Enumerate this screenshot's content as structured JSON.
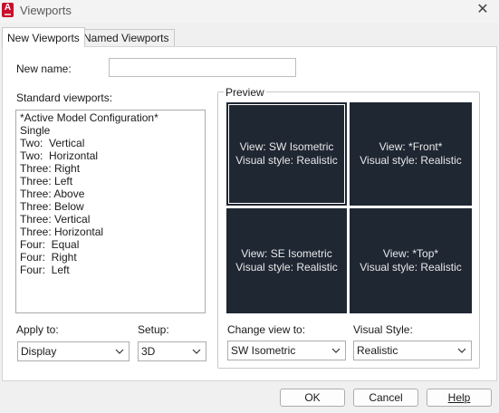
{
  "window": {
    "title": "Viewports",
    "close_glyph": "✕"
  },
  "tabs": [
    {
      "label": "New Viewports",
      "active": true
    },
    {
      "label": "Named Viewports",
      "active": false
    }
  ],
  "new_name": {
    "label": "New name:",
    "value": ""
  },
  "standard_viewports": {
    "label": "Standard viewports:",
    "items": [
      "*Active Model Configuration*",
      "Single",
      "Two:  Vertical",
      "Two:  Horizontal",
      "Three: Right",
      "Three: Left",
      "Three: Above",
      "Three: Below",
      "Three: Vertical",
      "Three: Horizontal",
      "Four:  Equal",
      "Four:  Right",
      "Four:  Left"
    ]
  },
  "preview": {
    "label": "Preview",
    "viewports": [
      {
        "view": "View: SW Isometric",
        "style": "Visual style: Realistic",
        "selected": true
      },
      {
        "view": "View: *Front*",
        "style": "Visual style: Realistic",
        "selected": false
      },
      {
        "view": "View: SE Isometric",
        "style": "Visual style: Realistic",
        "selected": false
      },
      {
        "view": "View: *Top*",
        "style": "Visual style: Realistic",
        "selected": false
      }
    ]
  },
  "apply_to": {
    "label": "Apply to:",
    "value": "Display"
  },
  "setup": {
    "label": "Setup:",
    "value": "3D"
  },
  "change_view_to": {
    "label": "Change view to:",
    "value": "SW Isometric"
  },
  "visual_style": {
    "label": "Visual Style:",
    "value": "Realistic"
  },
  "buttons": {
    "ok": "OK",
    "cancel": "Cancel",
    "help": "Help"
  },
  "colors": {
    "viewport_bg": "#1f2733",
    "app_icon": "#c8102e"
  }
}
